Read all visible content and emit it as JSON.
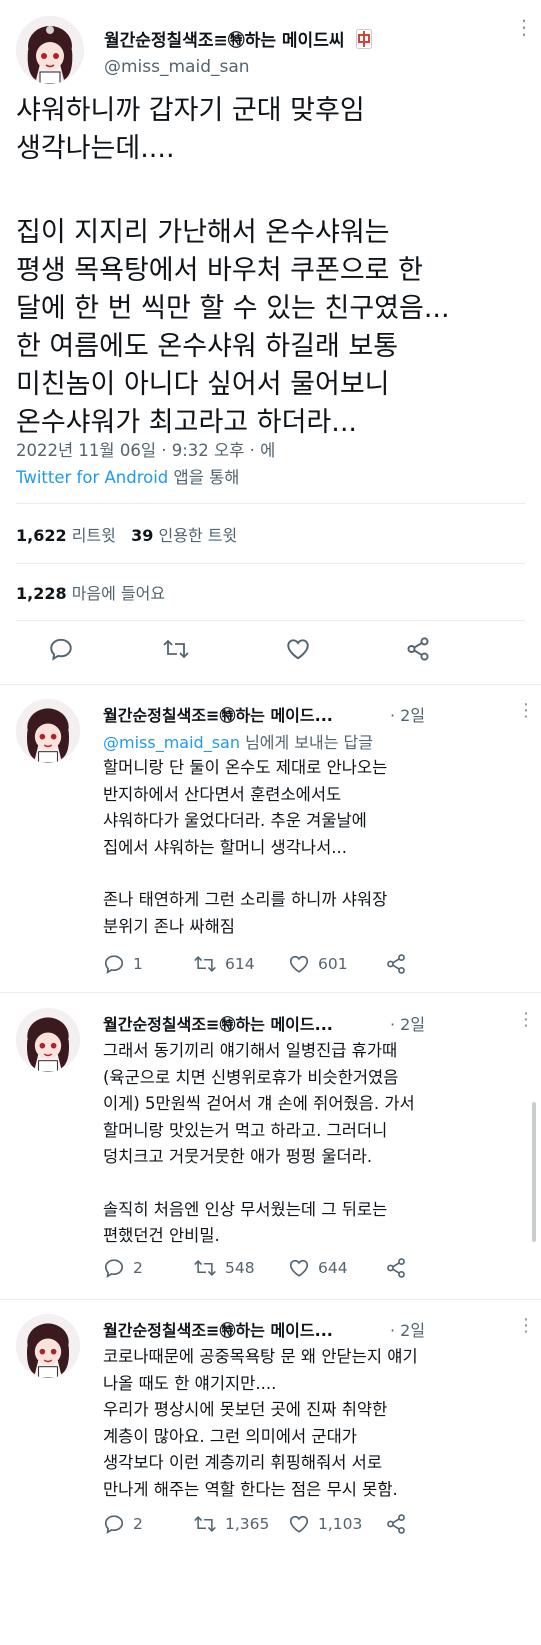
{
  "tweet": {
    "author_name": "월간순정칠색조≡㊕하는 메이드씨",
    "handle": "@miss_maid_san",
    "text_lines": [
      "샤워하니까 갑자기 군대 맞후임",
      "생각나는데....",
      "",
      "집이 지지리 가난해서 온수샤워는",
      "평생 목욕탕에서 바우처 쿠폰으로 한",
      "달에 한 번 씩만 할 수 있는 친구였음...",
      "한 여름에도 온수샤워 하길래 보통",
      "미친놈이 아니다 싶어서 물어보니",
      "온수샤워가 최고라고 하더라..."
    ],
    "timestamp": "2022년 11월 06일 · 9:32 오후 · 에",
    "source_app": "Twitter for Android",
    "source_suffix": " 앱을 통해",
    "retweets": "1,622",
    "retweets_label": "리트윗",
    "quotes": "39",
    "quotes_label": "인용한 트윗",
    "likes": "1,228",
    "likes_label": "마음에 들어요"
  },
  "replies": [
    {
      "author_name": "월간순정칠색조≡㊕하는 메이드...",
      "time": "· 2일",
      "replying_to": "@miss_maid_san",
      "replying_suffix": " 님에게 보내는 답글",
      "text_lines": [
        "할머니랑 단 둘이 온수도 제대로 안나오는",
        "반지하에서 산다면서 훈련소에서도",
        "샤워하다가 울었다더라. 추운 겨울날에",
        "집에서 샤워하는 할머니 생각나서...",
        "",
        "존나 태연하게 그런 소리를 하니까 샤워장",
        "분위기 존나 싸해짐"
      ],
      "replies_count": "1",
      "retweets_count": "614",
      "likes_count": "601"
    },
    {
      "author_name": "월간순정칠색조≡㊕하는 메이드...",
      "time": "· 2일",
      "text_lines": [
        "그래서 동기끼리 얘기해서 일병진급 휴가때",
        "(육군으로 치면 신병위로휴가 비슷한거였음",
        "이게) 5만원씩 걷어서 걔 손에 쥐어줬음. 가서",
        "할머니랑 맛있는거 먹고 하라고. 그러더니",
        "덩치크고 거뭇거뭇한 애가 펑펑 울더라.",
        "",
        "솔직히 처음엔 인상 무서웠는데 그 뒤로는",
        "편했던건 안비밀."
      ],
      "replies_count": "2",
      "retweets_count": "548",
      "likes_count": "644"
    },
    {
      "author_name": "월간순정칠색조≡㊕하는 메이드...",
      "time": "· 2일",
      "text_lines": [
        "코로나때문에 공중목욕탕 문 왜 안닫는지 얘기",
        "나올 때도 한 얘기지만....",
        "우리가 평상시에 못보던 곳에 진짜 취약한",
        "계층이 많아요. 그런 의미에서 군대가",
        "생각보다 이런 계층끼리 휘핑해줘서 서로",
        "만나게 해주는 역할 한다는 점은 무시 못함."
      ],
      "replies_count": "2",
      "retweets_count": "1,365",
      "likes_count": "1,103"
    }
  ],
  "colors": {
    "accent": "#1d9bf0",
    "text": "#0f1419",
    "muted": "#536471",
    "badge": "#d0453a"
  },
  "icons": [
    "reply-icon",
    "retweet-icon",
    "like-icon",
    "share-icon",
    "more-icon",
    "mahjong-badge-icon"
  ]
}
